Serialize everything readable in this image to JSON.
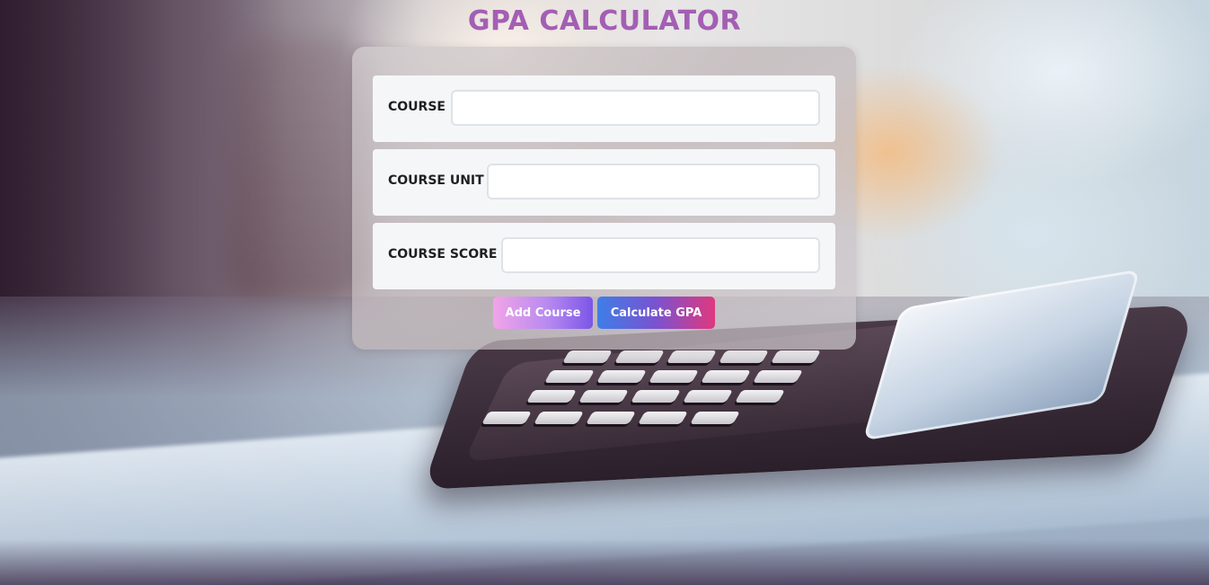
{
  "page": {
    "title": "GPA CALCULATOR"
  },
  "form": {
    "course": {
      "label": "COURSE",
      "value": "",
      "placeholder": ""
    },
    "course_unit": {
      "label": "COURSE UNIT",
      "value": "",
      "placeholder": ""
    },
    "course_score": {
      "label": "COURSE SCORE",
      "value": "",
      "placeholder": ""
    }
  },
  "actions": {
    "add_course_label": "Add Course",
    "calculate_gpa_label": "Calculate GPA"
  },
  "theme": {
    "title_color": "#a35fb3",
    "add_button_gradient": [
      "#f2a4e8",
      "#b78af0",
      "#7b55e8"
    ],
    "calculate_button_gradient": [
      "#3f7ee8",
      "#7a52cf",
      "#e0387e"
    ]
  }
}
